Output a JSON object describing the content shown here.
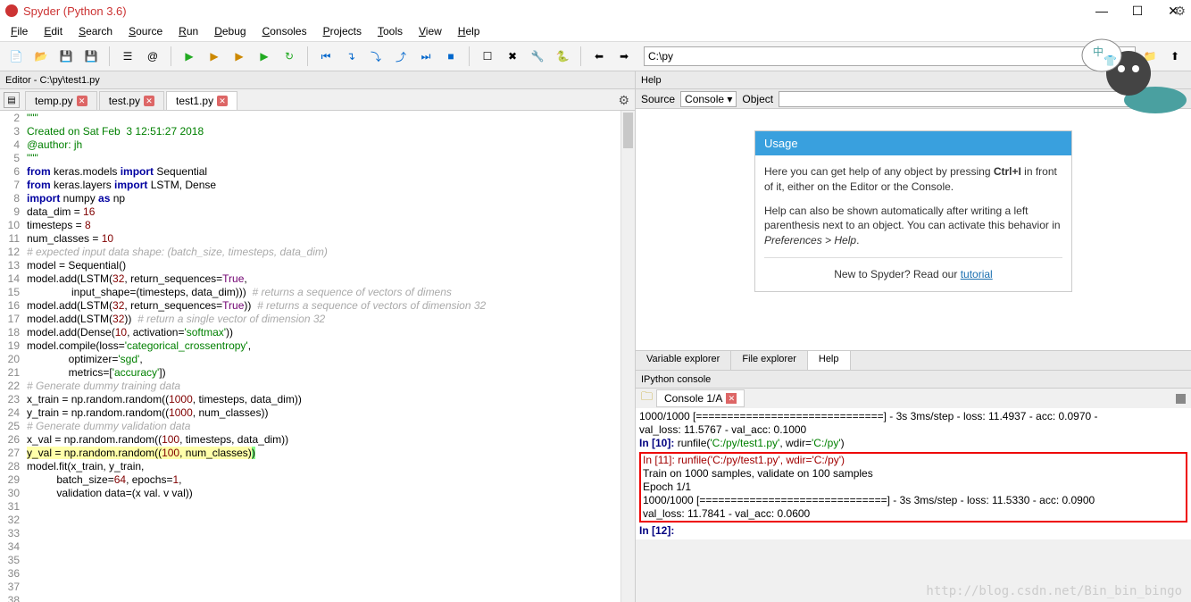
{
  "window": {
    "title": "Spyder (Python 3.6)",
    "controls": {
      "min": "—",
      "max": "☐",
      "close": "✕"
    }
  },
  "menu": [
    "File",
    "Edit",
    "Search",
    "Source",
    "Run",
    "Debug",
    "Consoles",
    "Projects",
    "Tools",
    "View",
    "Help"
  ],
  "toolbar_path": "C:\\py",
  "editor_title": "Editor - C:\\py\\test1.py",
  "editor_tabs": [
    {
      "label": "temp.py",
      "active": false,
      "closable": true
    },
    {
      "label": "test.py",
      "active": false,
      "closable": true
    },
    {
      "label": "test1.py",
      "active": true,
      "closable": true
    }
  ],
  "help": {
    "title": "Help",
    "source_label": "Source",
    "source_value": "Console ▾",
    "object_label": "Object",
    "usage_hdr": "Usage",
    "p1a": "Here you can get help of any object by pressing ",
    "p1b": "Ctrl+I",
    "p1c": " in front of it, either on the Editor or the Console.",
    "p2": "Help can also be shown automatically after writing a left parenthesis next to an object. You can activate this behavior in ",
    "p2i": "Preferences > Help",
    "p3": "New to Spyder? Read our ",
    "p3link": "tutorial"
  },
  "help_tabs": [
    "Variable explorer",
    "File explorer",
    "Help"
  ],
  "help_tab_active": "Help",
  "console": {
    "title": "IPython console",
    "tab": "Console 1/A",
    "lines_pre": [
      "1000/1000 [==============================] - 3s 3ms/step - loss: 11.4937 - acc: 0.0970 -",
      "val_loss: 11.5767 - val_acc: 0.1000",
      "",
      "In [10]: runfile('C:/py/test1.py', wdir='C:/py')"
    ],
    "boxed": [
      "In [11]: runfile('C:/py/test1.py', wdir='C:/py')",
      "Train on 1000 samples, validate on 100 samples",
      "Epoch 1/1",
      "1000/1000 [==============================] - 3s 3ms/step - loss: 11.5330 - acc: 0.0900",
      "val_loss: 11.7841 - val_acc: 0.0600"
    ],
    "post": "In [12]:"
  },
  "watermark": "http://blog.csdn.net/Bin_bin_bingo",
  "code_lines": [
    {
      "n": 2,
      "html": "<span class='str'>\"\"\"</span>"
    },
    {
      "n": 3,
      "html": "<span class='str'>Created on Sat Feb  3 12:51:27 2018</span>"
    },
    {
      "n": 4,
      "html": ""
    },
    {
      "n": 5,
      "html": "<span class='str'>@author: jh</span>"
    },
    {
      "n": 6,
      "html": "<span class='str'>\"\"\"</span>"
    },
    {
      "n": 7,
      "html": ""
    },
    {
      "n": 8,
      "html": "<span class='kw'>from</span> keras.models <span class='kw'>import</span> Sequential"
    },
    {
      "n": 9,
      "html": "<span class='kw'>from</span> keras.layers <span class='kw'>import</span> LSTM, Dense"
    },
    {
      "n": 10,
      "html": ""
    },
    {
      "n": 11,
      "html": "<span class='kw'>import</span> numpy <span class='kw'>as</span> np"
    },
    {
      "n": 12,
      "html": "data_dim = <span class='num'>16</span>"
    },
    {
      "n": 13,
      "html": "timesteps = <span class='num'>8</span>"
    },
    {
      "n": 14,
      "html": "num_classes = <span class='num'>10</span>"
    },
    {
      "n": 15,
      "html": ""
    },
    {
      "n": 16,
      "html": "<span class='cmt'># expected input data shape: (batch_size, timesteps, data_dim)</span>"
    },
    {
      "n": 17,
      "html": "model = Sequential()"
    },
    {
      "n": 18,
      "html": "model.add(LSTM(<span class='num'>32</span>, return_sequences=<span class='builtin'>True</span>,"
    },
    {
      "n": 19,
      "html": "               input_shape=(timesteps, data_dim)))  <span class='cmt'># returns a sequence of vectors of dimens</span>"
    },
    {
      "n": 20,
      "html": "model.add(LSTM(<span class='num'>32</span>, return_sequences=<span class='builtin'>True</span>))  <span class='cmt'># returns a sequence of vectors of dimension 32</span>"
    },
    {
      "n": 21,
      "html": "model.add(LSTM(<span class='num'>32</span>))  <span class='cmt'># return a single vector of dimension 32</span>"
    },
    {
      "n": 22,
      "html": "model.add(Dense(<span class='num'>10</span>, activation=<span class='str'>'softmax'</span>))"
    },
    {
      "n": 23,
      "html": ""
    },
    {
      "n": 24,
      "html": "model.compile(loss=<span class='str'>'categorical_crossentropy'</span>,"
    },
    {
      "n": 25,
      "html": "              optimizer=<span class='str'>'sgd'</span>,"
    },
    {
      "n": 26,
      "html": "              metrics=[<span class='str'>'accuracy'</span>])"
    },
    {
      "n": 27,
      "html": ""
    },
    {
      "n": 28,
      "html": "<span class='cmt'># Generate dummy training data</span>"
    },
    {
      "n": 29,
      "html": "x_train = np.random.random((<span class='num'>1000</span>, timesteps, data_dim))"
    },
    {
      "n": 30,
      "html": "y_train = np.random.random((<span class='num'>1000</span>, num_classes))"
    },
    {
      "n": 31,
      "html": ""
    },
    {
      "n": 32,
      "html": "<span class='cmt'># Generate dummy validation data</span>"
    },
    {
      "n": 33,
      "html": "x_val = np.random.random((<span class='num'>100</span>, timesteps, data_dim))"
    },
    {
      "n": 34,
      "html": "<span class='hl'>y_val = np.random.random((<span class='num'>100</span>, num_classes)<span style='background:#88ff88'>)</span></span>"
    },
    {
      "n": 35,
      "html": ""
    },
    {
      "n": 36,
      "html": "model.fit(x_train, y_train,"
    },
    {
      "n": 37,
      "html": "          batch_size=<span class='num'>64</span>, epochs=<span class='num'>1</span>,"
    },
    {
      "n": 38,
      "html": "          validation data=(x val. v val))"
    }
  ]
}
